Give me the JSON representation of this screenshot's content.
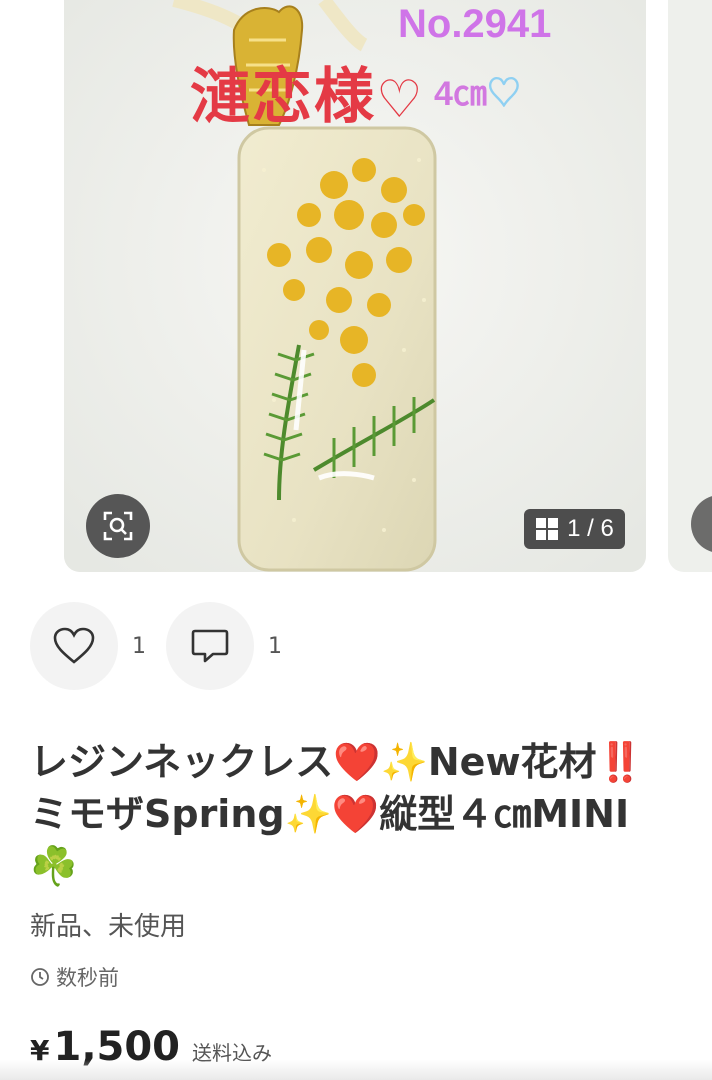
{
  "gallery": {
    "overlay": {
      "number": "No.2941",
      "name": "漣恋様",
      "heart": "♡",
      "size": "4㎝",
      "heart_blue": "♡"
    },
    "counter": "1 / 6",
    "zoom_icon": "zoom-icon",
    "grid_icon": "grid-icon"
  },
  "actions": {
    "like_count": "1",
    "comment_count": "1"
  },
  "item": {
    "title": "レジンネックレス❤️✨New花材‼️ミモザSpring✨❤️縦型４㎝MINI☘️",
    "condition": "新品、未使用",
    "posted_time": "数秒前",
    "price_symbol": "¥",
    "price_value": "1,500",
    "shipping": "送料込み"
  },
  "colors": {
    "overlay_number": "#cf74e8",
    "overlay_name": "#e43a45",
    "button_bg": "#f3f3f3"
  }
}
